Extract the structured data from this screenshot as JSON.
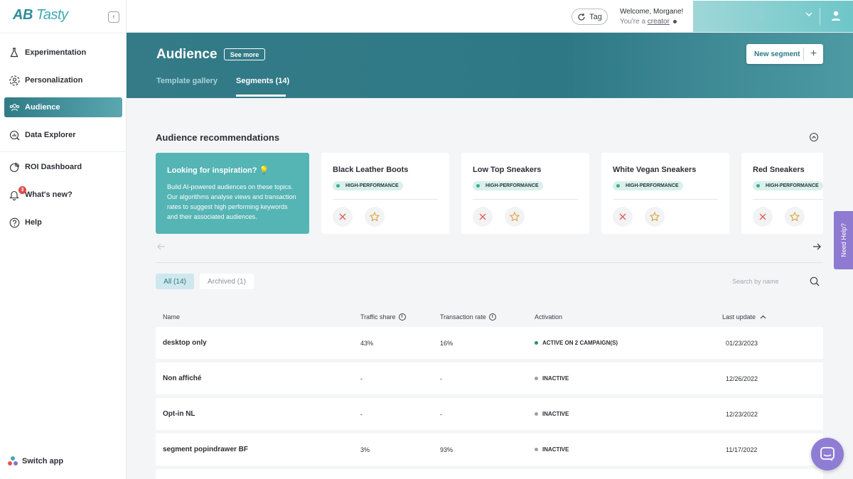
{
  "brand": {
    "logo_ab": "AB",
    "logo_tasty": "Tasty"
  },
  "sidebar": {
    "items": [
      {
        "label": "Experimentation",
        "icon": "flask-icon"
      },
      {
        "label": "Personalization",
        "icon": "person-target-icon"
      },
      {
        "label": "Audience",
        "icon": "audience-icon",
        "active": true
      },
      {
        "label": "Data Explorer",
        "icon": "chart-search-icon"
      },
      {
        "label": "ROI Dashboard",
        "icon": "pie-chart-icon"
      },
      {
        "label": "What's new?",
        "icon": "bell-icon",
        "badge": "3"
      },
      {
        "label": "Help",
        "icon": "help-icon"
      }
    ],
    "switch_app": "Switch app"
  },
  "topbar": {
    "tag_label": "Tag",
    "welcome": "Welcome, Morgane!",
    "role_prefix": "You're a",
    "role": "creator"
  },
  "header": {
    "title": "Audience",
    "see_more": "See more",
    "tabs": [
      {
        "label": "Template gallery",
        "active": false
      },
      {
        "label": "Segments (14)",
        "active": true
      }
    ],
    "new_segment": "New segment",
    "plus": "+"
  },
  "recommendations": {
    "title": "Audience recommendations",
    "inspiration": {
      "title": "Looking for inspiration?",
      "body": "Build AI-powered audiences on these topics. Our algorithms analyse views and transaction rates to suggest high performing keywords and their associated audiences."
    },
    "cards": [
      {
        "name": "Black Leather Boots",
        "badge": "HIGH-PERFORMANCE"
      },
      {
        "name": "Low Top Sneakers",
        "badge": "HIGH-PERFORMANCE"
      },
      {
        "name": "White Vegan Sneakers",
        "badge": "HIGH-PERFORMANCE"
      },
      {
        "name": "Red Sneakers",
        "badge": "HIGH-PERFORMANCE"
      }
    ]
  },
  "filters": {
    "all": "All (14)",
    "archived": "Archived (1)",
    "search_placeholder": "Search by name"
  },
  "table": {
    "headers": {
      "name": "Name",
      "traffic": "Traffic share",
      "transaction": "Transaction rate",
      "activation": "Activation",
      "last_update": "Last update"
    },
    "rows": [
      {
        "name": "desktop only",
        "traffic": "43%",
        "transaction": "16%",
        "activation": "ACTIVE ON 2 CAMPAIGN(S)",
        "status": "active",
        "last_update": "01/23/2023"
      },
      {
        "name": "Non affiché",
        "traffic": "-",
        "transaction": "-",
        "activation": "INACTIVE",
        "status": "inactive",
        "last_update": "12/26/2022"
      },
      {
        "name": "Opt-in NL",
        "traffic": "-",
        "transaction": "-",
        "activation": "INACTIVE",
        "status": "inactive",
        "last_update": "12/23/2022"
      },
      {
        "name": "segment popindrawer BF",
        "traffic": "3%",
        "transaction": "93%",
        "activation": "INACTIVE",
        "status": "inactive",
        "last_update": "11/17/2022"
      }
    ]
  },
  "floating": {
    "need_help": "Need Help?"
  },
  "colors": {
    "active_status": "#2e8c74",
    "inactive_status": "#9aa0a8",
    "accent": "#2e7886"
  }
}
